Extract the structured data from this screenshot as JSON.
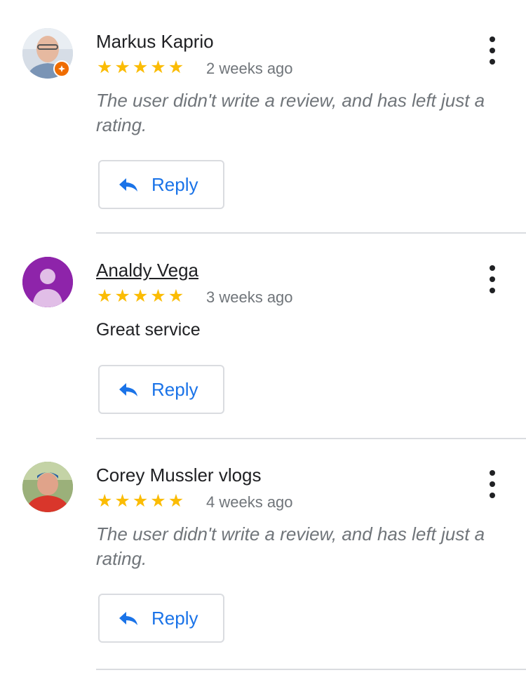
{
  "reviews": [
    {
      "name": "Markus Kaprio",
      "rating": 5,
      "stars": "★★★★★",
      "time": "2 weeks ago",
      "text": "The user didn't write a review, and has left just a rating.",
      "reply_label": "Reply",
      "avatar_icon": "person-photo"
    },
    {
      "name": "Analdy Vega",
      "rating": 5,
      "stars": "★★★★★",
      "time": "3 weeks ago",
      "text": "Great service",
      "reply_label": "Reply",
      "avatar_icon": "default-person-icon"
    },
    {
      "name": "Corey Mussler vlogs",
      "rating": 5,
      "stars": "★★★★★",
      "time": "4 weeks ago",
      "text": "The user didn't write a review, and has left just a rating.",
      "reply_label": "Reply",
      "avatar_icon": "person-photo"
    }
  ],
  "colors": {
    "star": "#fbbc04",
    "link_blue": "#1a73e8",
    "avatar_purple": "#8e24aa",
    "local_guide_badge": "#ef6c00"
  }
}
